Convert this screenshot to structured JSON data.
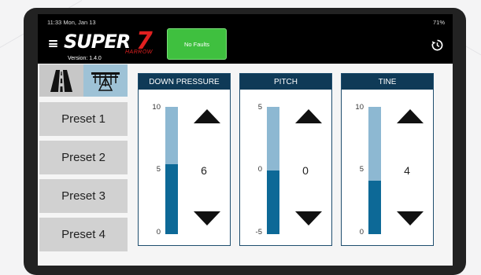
{
  "status_bar": {
    "time": "11:33",
    "date": "Mon, Jan 13",
    "battery": "71%"
  },
  "app": {
    "logo_text": "SUPER",
    "logo_number": "7",
    "logo_sub": "HARROW",
    "version": "Version: 1.4.0",
    "faults_label": "No Faults"
  },
  "icons": {
    "menu": "hamburger-icon",
    "history": "history-icon",
    "road": "road-icon",
    "harrow": "harrow-icon"
  },
  "presets": [
    "Preset 1",
    "Preset 2",
    "Preset 3",
    "Preset 4"
  ],
  "panels": [
    {
      "title": "DOWN PRESSURE",
      "max": "10",
      "mid": "5",
      "min": "0",
      "value": "6",
      "fill_fraction": 0.55
    },
    {
      "title": "PITCH",
      "max": "5",
      "mid": "0",
      "min": "-5",
      "value": "0",
      "fill_fraction": 0.5
    },
    {
      "title": "TINE",
      "max": "10",
      "mid": "5",
      "min": "0",
      "value": "4",
      "fill_fraction": 0.42
    }
  ],
  "colors": {
    "faults_ok": "#3fc03f",
    "panel_header": "#0f3a57",
    "gauge_fill": "#0d6997",
    "gauge_track": "#8db8d2",
    "brand_red": "#e02020"
  }
}
